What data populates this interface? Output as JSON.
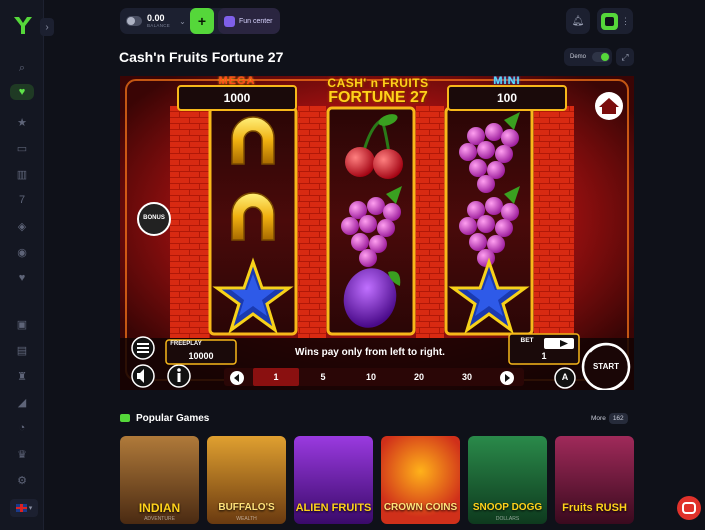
{
  "header": {
    "balance_amount": "0.00",
    "balance_label": "BALANCE",
    "deposit_label": "+",
    "fun_center_label": "Fun center"
  },
  "page": {
    "title": "Cash'n Fruits Fortune 27",
    "demo_label": "Demo"
  },
  "game": {
    "logo_line1": "CASH' n FRUITS",
    "logo_line2": "FORTUNE 27",
    "jackpot_left_label": "MEGA",
    "jackpot_left_value": "1000",
    "jackpot_right_label": "MINI",
    "jackpot_right_value": "100",
    "bonus_label": "BONUS",
    "freeplay_label": "FREEPLAY",
    "freeplay_value": "10000",
    "message": "Wins pay only from left to right.",
    "bet_label": "BET",
    "bet_value": "1",
    "lines": [
      "1",
      "5",
      "10",
      "20",
      "30"
    ],
    "selected_line": "1",
    "start_label": "START",
    "auto_label": "A",
    "reels": [
      [
        "horseshoe",
        "horseshoe",
        "star"
      ],
      [
        "cherry",
        "grapes",
        "plum"
      ],
      [
        "grapes",
        "grapes",
        "star"
      ]
    ]
  },
  "popular": {
    "title": "Popular Games",
    "more_label": "More",
    "more_count": "162",
    "games": [
      {
        "title": "INDIAN",
        "sub": "ADVENTURE",
        "bg": "#6b4a2a"
      },
      {
        "title": "BUFFALO'S",
        "sub": "WEALTH",
        "bg": "#8a5a22"
      },
      {
        "title": "ALIEN FRUITS",
        "sub": "",
        "bg": "#5a1e8a"
      },
      {
        "title": "CROWN COINS",
        "sub": "",
        "bg": "#d0301a"
      },
      {
        "title": "SNOOP DOGG",
        "sub": "DOLLARS",
        "bg": "#1e6a38"
      },
      {
        "title": "Fruits RUSH",
        "sub": "",
        "bg": "#6a1a3e"
      }
    ]
  },
  "colors": {
    "accent": "#55d73a",
    "page_bg": "#0f1119",
    "panel": "#1c2030",
    "chat": "#e0322b"
  }
}
